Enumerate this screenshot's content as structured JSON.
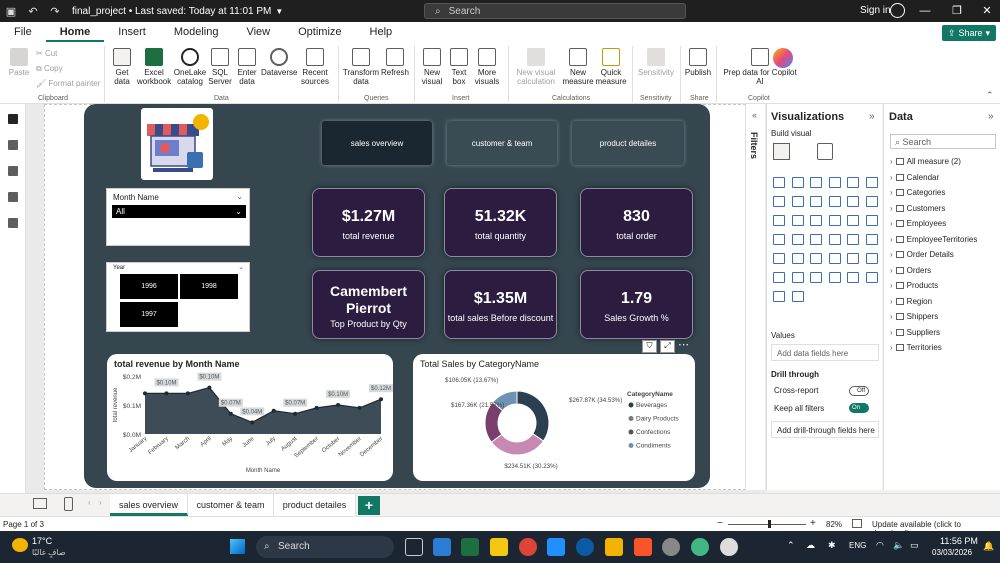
{
  "titlebar": {
    "title": "final_project • Last saved: Today at 11:01 PM",
    "search_placeholder": "Search",
    "signin": "Sign in"
  },
  "menu": [
    "File",
    "Home",
    "Insert",
    "Modeling",
    "View",
    "Optimize",
    "Help"
  ],
  "share": "Share",
  "ribbon": {
    "paste": "Paste",
    "cut": "Cut",
    "copy": "Copy",
    "format_painter": "Format painter",
    "get_data": "Get data",
    "excel": "Excel workbook",
    "onelake": "OneLake catalog",
    "sql": "SQL Server",
    "enter": "Enter data",
    "dataverse": "Dataverse",
    "recent": "Recent sources",
    "transform": "Transform data",
    "refresh": "Refresh",
    "new_visual": "New visual",
    "text_box": "Text box",
    "more_visuals": "More visuals",
    "new_calc": "New visual calculation",
    "new_measure": "New measure",
    "quick_measure": "Quick measure",
    "sensitivity": "Sensitivity",
    "publish": "Publish",
    "copilot": "Prep data for Copilot AI",
    "groups": {
      "clipboard": "Clipboard",
      "data": "Data",
      "queries": "Queries",
      "insert": "Insert",
      "calculations": "Calculations",
      "sensitivity": "Sensitivity",
      "share": "Share",
      "copilot": "Copilot"
    }
  },
  "report": {
    "nav": [
      "sales overview",
      "customer & team",
      "product detailes"
    ],
    "month_slicer": {
      "title": "Month Name",
      "value": "All"
    },
    "year_slicer": {
      "title": "Year",
      "years": [
        "1996",
        "1998",
        "1997"
      ]
    },
    "kpis": [
      {
        "value": "$1.27M",
        "label": "total revenue"
      },
      {
        "value": "51.32K",
        "label": "total quantity"
      },
      {
        "value": "830",
        "label": "total order"
      },
      {
        "value": "Camembert Pierrot",
        "label": "Top Product by Qty"
      },
      {
        "value": "$1.35M",
        "label": "total sales Before discount"
      },
      {
        "value": "1.79",
        "label": "Sales Growth %"
      }
    ]
  },
  "chart_data": [
    {
      "type": "area",
      "title": "total revenue by Month Name",
      "xlabel": "Month Name",
      "ylabel": "total revenue",
      "yticks": [
        "$0.0M",
        "$0.1M",
        "$0.2M"
      ],
      "ylim": [
        0,
        0.2
      ],
      "categories": [
        "January",
        "February",
        "March",
        "April",
        "May",
        "June",
        "July",
        "August",
        "September",
        "October",
        "November",
        "December"
      ],
      "values": [
        0.14,
        0.14,
        0.14,
        0.16,
        0.07,
        0.04,
        0.08,
        0.07,
        0.09,
        0.1,
        0.09,
        0.12
      ],
      "data_labels": [
        "$0.10M",
        "$0.10M",
        "$0.07M",
        "$0.04M",
        "$0.07M",
        "$0.10M",
        "$0.12M"
      ]
    },
    {
      "type": "pie",
      "title": "Total Sales by CategoryName",
      "legend_title": "CategoryName",
      "categories": [
        "Beverages",
        "Dairy Products",
        "Confections",
        "Condiments"
      ],
      "values": [
        267.87,
        234.51,
        167.36,
        106.05
      ],
      "data_labels": [
        "$267.87K (34.53%)",
        "$234.51K (30.23%)",
        "$167.36K (21.57%)",
        "$106.05K (13.67%)"
      ],
      "colors": [
        "#2a3f50",
        "#c788b1",
        "#7a3e6d",
        "#6d92b4"
      ]
    }
  ],
  "panes": {
    "filters": "Filters",
    "viz_title": "Visualizations",
    "build_visual": "Build visual",
    "values": "Values",
    "add_fields": "Add data fields here",
    "drill": "Drill through",
    "cross": "Cross-report",
    "cross_state": "Off",
    "keep": "Keep all filters",
    "keep_state": "On",
    "add_drill": "Add drill-through fields here",
    "data_title": "Data",
    "data_search": "Search",
    "tables": [
      "All measure (2)",
      "Calendar",
      "Categories",
      "Customers",
      "Employees",
      "EmployeeTerritories",
      "Order Details",
      "Orders",
      "Products",
      "Region",
      "Shippers",
      "Suppliers",
      "Territories"
    ]
  },
  "tabs": [
    "sales overview",
    "customer & team",
    "product detailes"
  ],
  "status": {
    "page": "Page 1 of 3",
    "zoom": "82%",
    "update": "Update available (click to download)"
  },
  "taskbar": {
    "weather_temp": "17°C",
    "weather_desc": "صافٍ غالبًا",
    "search": "Search",
    "lang": "ENG",
    "time": "11:56 PM",
    "date": "03/03/2026"
  }
}
